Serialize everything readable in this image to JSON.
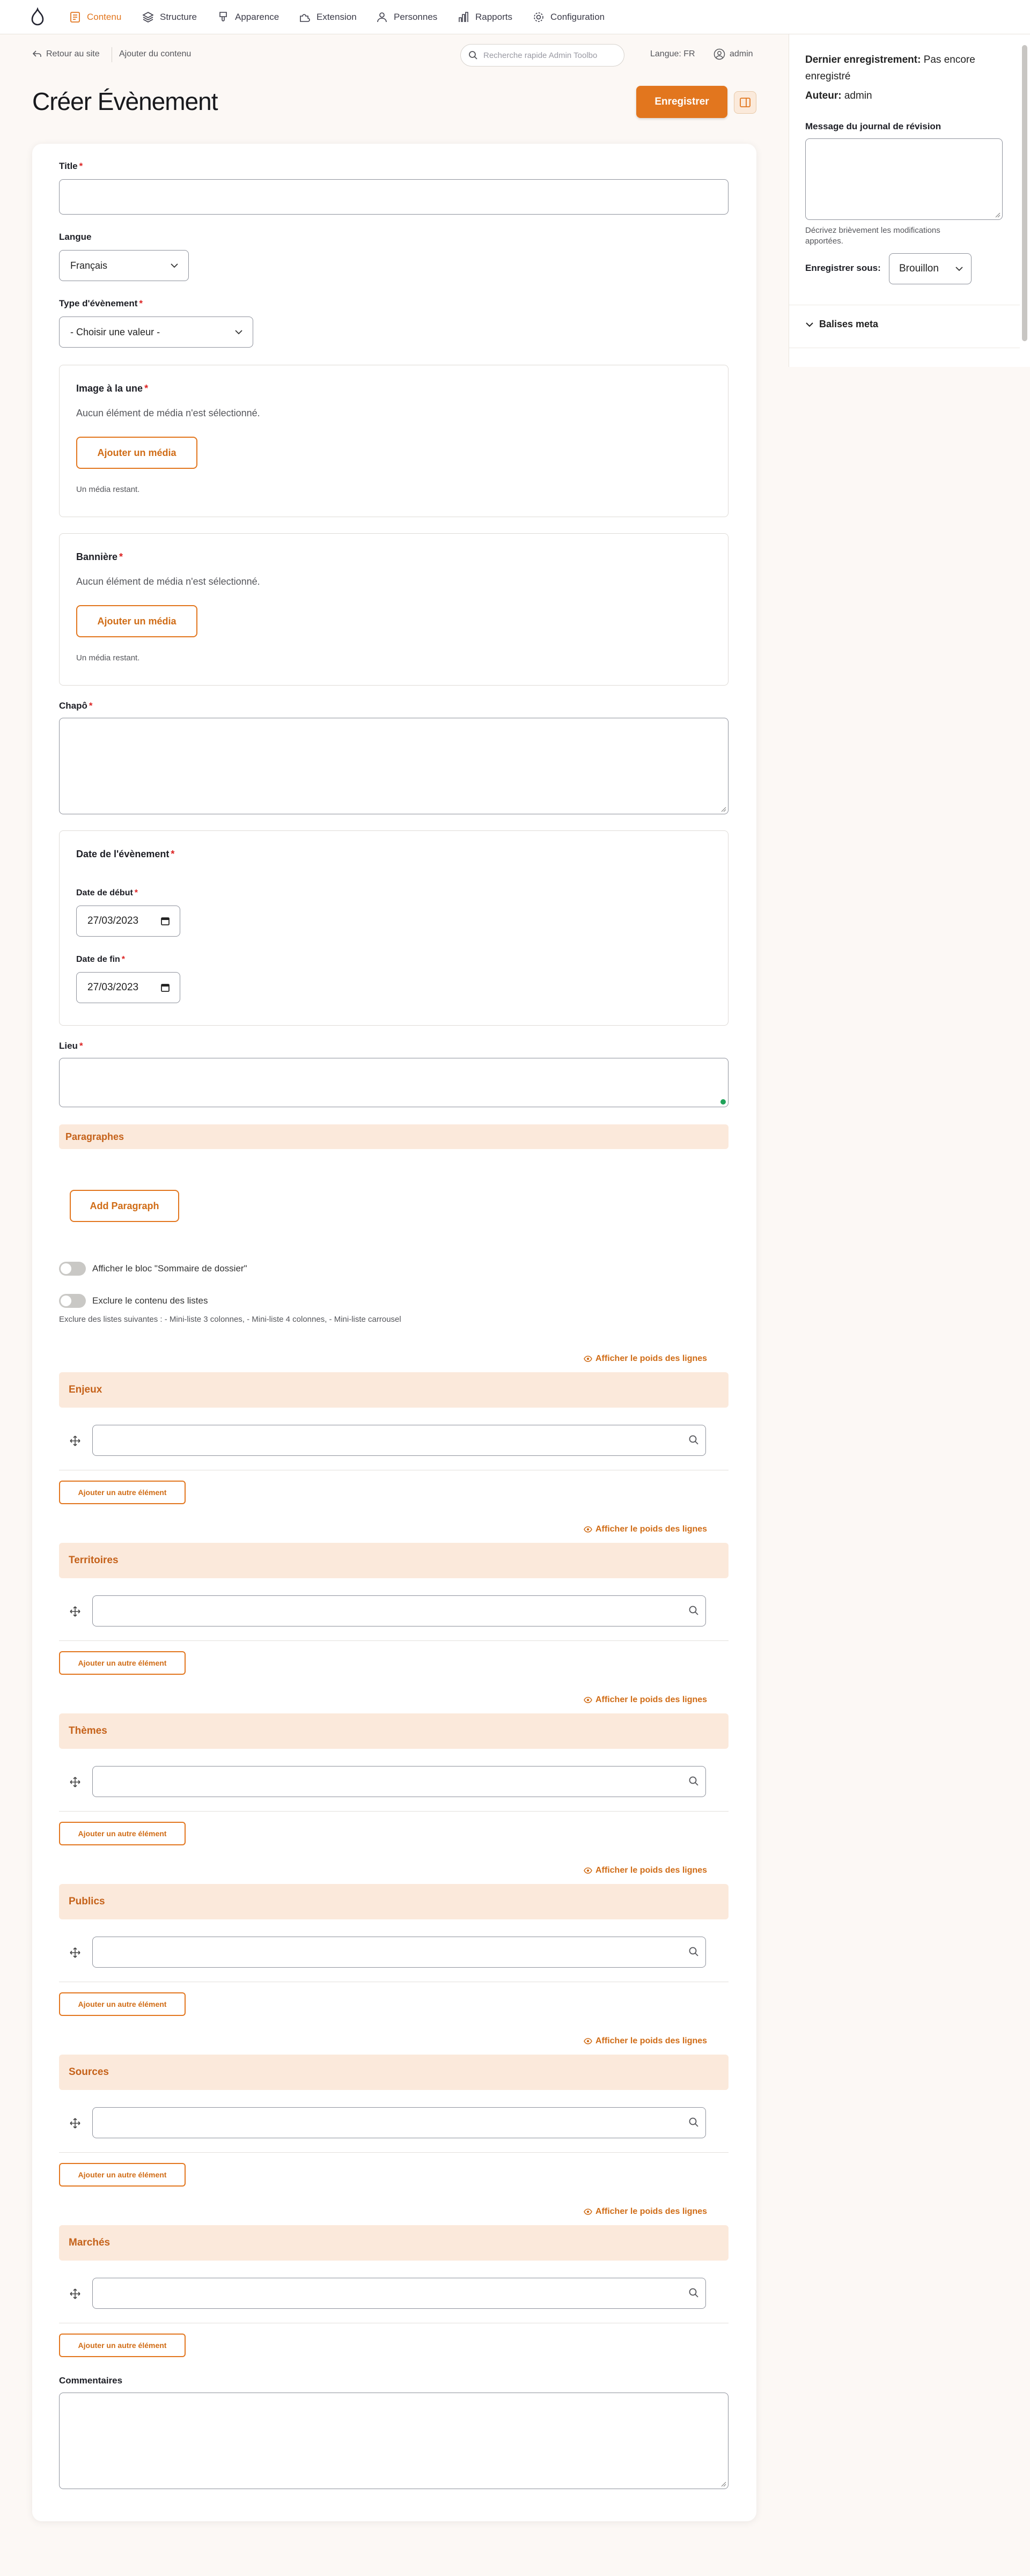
{
  "nav": {
    "items": [
      {
        "label": "Contenu",
        "icon": "content-icon"
      },
      {
        "label": "Structure",
        "icon": "structure-icon"
      },
      {
        "label": "Apparence",
        "icon": "appearance-icon"
      },
      {
        "label": "Extension",
        "icon": "extension-icon"
      },
      {
        "label": "Personnes",
        "icon": "people-icon"
      },
      {
        "label": "Rapports",
        "icon": "reports-icon"
      },
      {
        "label": "Configuration",
        "icon": "gear-icon"
      }
    ],
    "accent": "#e2761e"
  },
  "toolbar": {
    "back_label": "Retour au site",
    "add_content_label": "Ajouter du contenu",
    "search_placeholder": "Recherche rapide Admin Toolbo",
    "language": "Langue: FR",
    "user": "admin"
  },
  "page": {
    "title": "Créer Évènement",
    "save_label": "Enregistrer"
  },
  "sidebar": {
    "last_saved_label": "Dernier enregistrement:",
    "last_saved_value": "Pas encore enregistré",
    "author_label": "Auteur:",
    "author_value": "admin",
    "revision_label": "Message du journal de révision",
    "revision_help": "Décrivez brièvement les modifications apportées.",
    "save_as_label": "Enregistrer sous:",
    "save_as_value": "Brouillon",
    "meta_label": "Balises meta"
  },
  "form": {
    "title_label": "Title",
    "langue_label": "Langue",
    "langue_value": "Français",
    "type_label": "Type d'évènement",
    "type_value": "- Choisir une valeur -",
    "image": {
      "label": "Image à la une",
      "empty": "Aucun élément de média n'est sélectionné.",
      "button": "Ajouter un média",
      "remaining": "Un média restant."
    },
    "banner": {
      "label": "Bannière",
      "empty": "Aucun élément de média n'est sélectionné.",
      "button": "Ajouter un média",
      "remaining": "Un média restant."
    },
    "chapo_label": "Chapô",
    "date": {
      "legend": "Date de l'évènement",
      "start_label": "Date de début",
      "start_value": "27/03/2023",
      "end_label": "Date de fin",
      "end_value": "27/03/2023"
    },
    "lieu_label": "Lieu",
    "paragraphs_label": "Paragraphes",
    "add_paragraph": "Add Paragraph",
    "toggle_summary": "Afficher le bloc \"Sommaire de dossier\"",
    "toggle_exclude": "Exclure le contenu des listes",
    "exclude_help": "Exclure des listes suivantes : - Mini-liste 3 colonnes, - Mini-liste 4 colonnes, - Mini-liste carrousel",
    "weights_label": "Afficher le poids des lignes",
    "add_item_label": "Ajouter un autre élément",
    "taxonomies": [
      "Enjeux",
      "Territoires",
      "Thèmes",
      "Publics",
      "Sources",
      "Marchés"
    ],
    "comments_label": "Commentaires"
  }
}
